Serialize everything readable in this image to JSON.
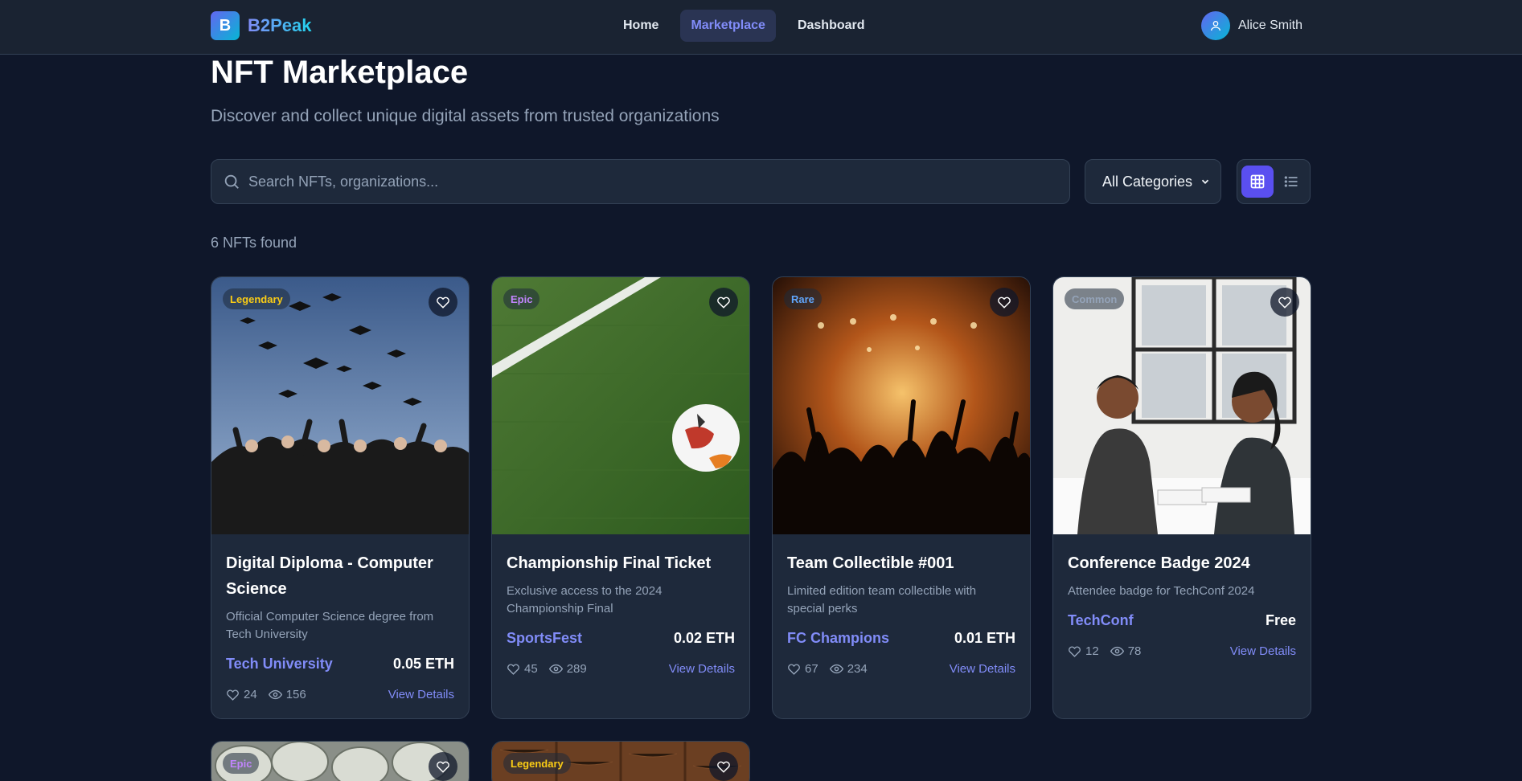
{
  "nav": {
    "brand_letter": "B",
    "brand_name": "B2Peak",
    "links": [
      "Home",
      "Marketplace",
      "Dashboard"
    ],
    "active": "Marketplace",
    "user_name": "Alice Smith"
  },
  "header": {
    "title": "NFT Marketplace",
    "subtitle": "Discover and collect unique digital assets from trusted organizations"
  },
  "search": {
    "placeholder": "Search NFTs, organizations..."
  },
  "filter": {
    "category": "All Categories"
  },
  "results": {
    "count_text": "6 NFTs found"
  },
  "cards": [
    {
      "badge": "Legendary",
      "title": "Digital Diploma - Computer Science",
      "description": "Official Computer Science degree from Tech University",
      "org": "Tech University",
      "price": "0.05 ETH",
      "likes": "24",
      "views": "156",
      "action": "View Details"
    },
    {
      "badge": "Epic",
      "title": "Championship Final Ticket",
      "description": "Exclusive access to the 2024 Championship Final",
      "org": "SportsFest",
      "price": "0.02 ETH",
      "likes": "45",
      "views": "289",
      "action": "View Details"
    },
    {
      "badge": "Rare",
      "title": "Team Collectible #001",
      "description": "Limited edition team collectible with special perks",
      "org": "FC Champions",
      "price": "0.01 ETH",
      "likes": "67",
      "views": "234",
      "action": "View Details"
    },
    {
      "badge": "Common",
      "title": "Conference Badge 2024",
      "description": "Attendee badge for TechConf 2024",
      "org": "TechConf",
      "price": "Free",
      "likes": "12",
      "views": "78",
      "action": "View Details"
    },
    {
      "badge": "Epic"
    },
    {
      "badge": "Legendary"
    }
  ],
  "colors": {
    "accent": "#818cf8",
    "background": "#0f172a",
    "card": "#1e293b",
    "active_toggle": "#5a4ff0"
  }
}
